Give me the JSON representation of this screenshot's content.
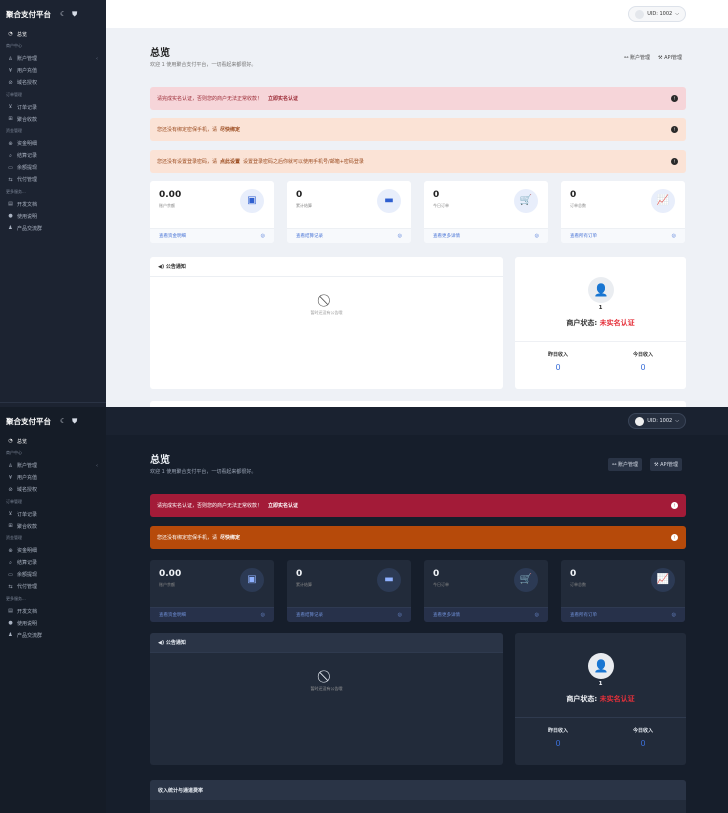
{
  "app": {
    "brand": "聚合支付平台",
    "brand_icons": [
      "moon-icon",
      "shield-icon"
    ]
  },
  "sidebar": {
    "items": [
      {
        "type": "item",
        "label": "总览",
        "icon": "dashboard-icon",
        "active": true
      },
      {
        "type": "group",
        "label": "商户中心"
      },
      {
        "type": "item",
        "label": "账户管理",
        "icon": "user-icon",
        "arrow": "‹"
      },
      {
        "type": "item",
        "label": "用户充值",
        "icon": "yen-icon"
      },
      {
        "type": "item",
        "label": "域名授权",
        "icon": "link-icon"
      },
      {
        "type": "group",
        "label": "订单管理"
      },
      {
        "type": "item",
        "label": "订单记录",
        "icon": "cart-icon"
      },
      {
        "type": "item",
        "label": "聚合收款",
        "icon": "grid-icon"
      },
      {
        "type": "group",
        "label": "资金管理"
      },
      {
        "type": "item",
        "label": "资金明细",
        "icon": "search-money-icon"
      },
      {
        "type": "item",
        "label": "结算记录",
        "icon": "search-icon"
      },
      {
        "type": "item",
        "label": "余额提现",
        "icon": "card-icon"
      },
      {
        "type": "item",
        "label": "代付管理",
        "icon": "transfer-icon"
      },
      {
        "type": "group",
        "label": "更多服务..."
      },
      {
        "type": "item",
        "label": "开发文档",
        "icon": "doc-icon"
      },
      {
        "type": "item",
        "label": "使用说明",
        "icon": "help-icon"
      },
      {
        "type": "item",
        "label": "产品交流群",
        "icon": "group-icon"
      }
    ]
  },
  "topbar": {
    "uid_label": "UID: 1002",
    "chevron": "⌵"
  },
  "header": {
    "title": "总览",
    "subtitle": "欢迎 1 使用聚合支付平台，一切看起来都很好。",
    "links": [
      {
        "label": "账户管理",
        "icon": "users-icon"
      },
      {
        "label": "API管理",
        "icon": "wrench-icon"
      }
    ]
  },
  "alerts": {
    "realname": {
      "text": "请完成实名认证，否则您的商户无法正常收款！",
      "link": "立即实名认证"
    },
    "phone": {
      "text": "您还没有绑定密保手机，请",
      "link": "尽快绑定"
    },
    "password": {
      "text_before": "您还没有设置登录密码，请",
      "link": "点此设置",
      "text_after": "设置登录密码之后你就可以使用手机号/邮箱+密码登录"
    }
  },
  "stats": [
    {
      "value": "0.00",
      "label": "账户余额",
      "link": "查看资金明细",
      "icon": "wallet-icon"
    },
    {
      "value": "0",
      "label": "累计结算",
      "link": "查看结算记录",
      "icon": "payment-icon"
    },
    {
      "value": "0",
      "label": "今日订单",
      "link": "查看更多详情",
      "icon": "cart-icon"
    },
    {
      "value": "0",
      "label": "订单总数",
      "link": "查看所有订单",
      "icon": "chart-icon"
    }
  ],
  "announcement": {
    "title": "公告通知",
    "empty": "暂时还没有公告哦"
  },
  "profile": {
    "uid": "1",
    "status_label": "商户状态:",
    "status_value": "未实名认证",
    "yesterday_label": "昨日收入",
    "yesterday_value": "0",
    "today_label": "今日收入",
    "today_value": "0"
  },
  "income_panel": {
    "title": "收入统计与通道费率"
  },
  "colors": {
    "danger": "#e5303a",
    "accent": "#3b6fd8",
    "light_bg": "#eef1f6",
    "dark_bg": "#161e2b",
    "dark_alert_red": "#a31b38",
    "dark_alert_orange": "#b64a0a"
  }
}
